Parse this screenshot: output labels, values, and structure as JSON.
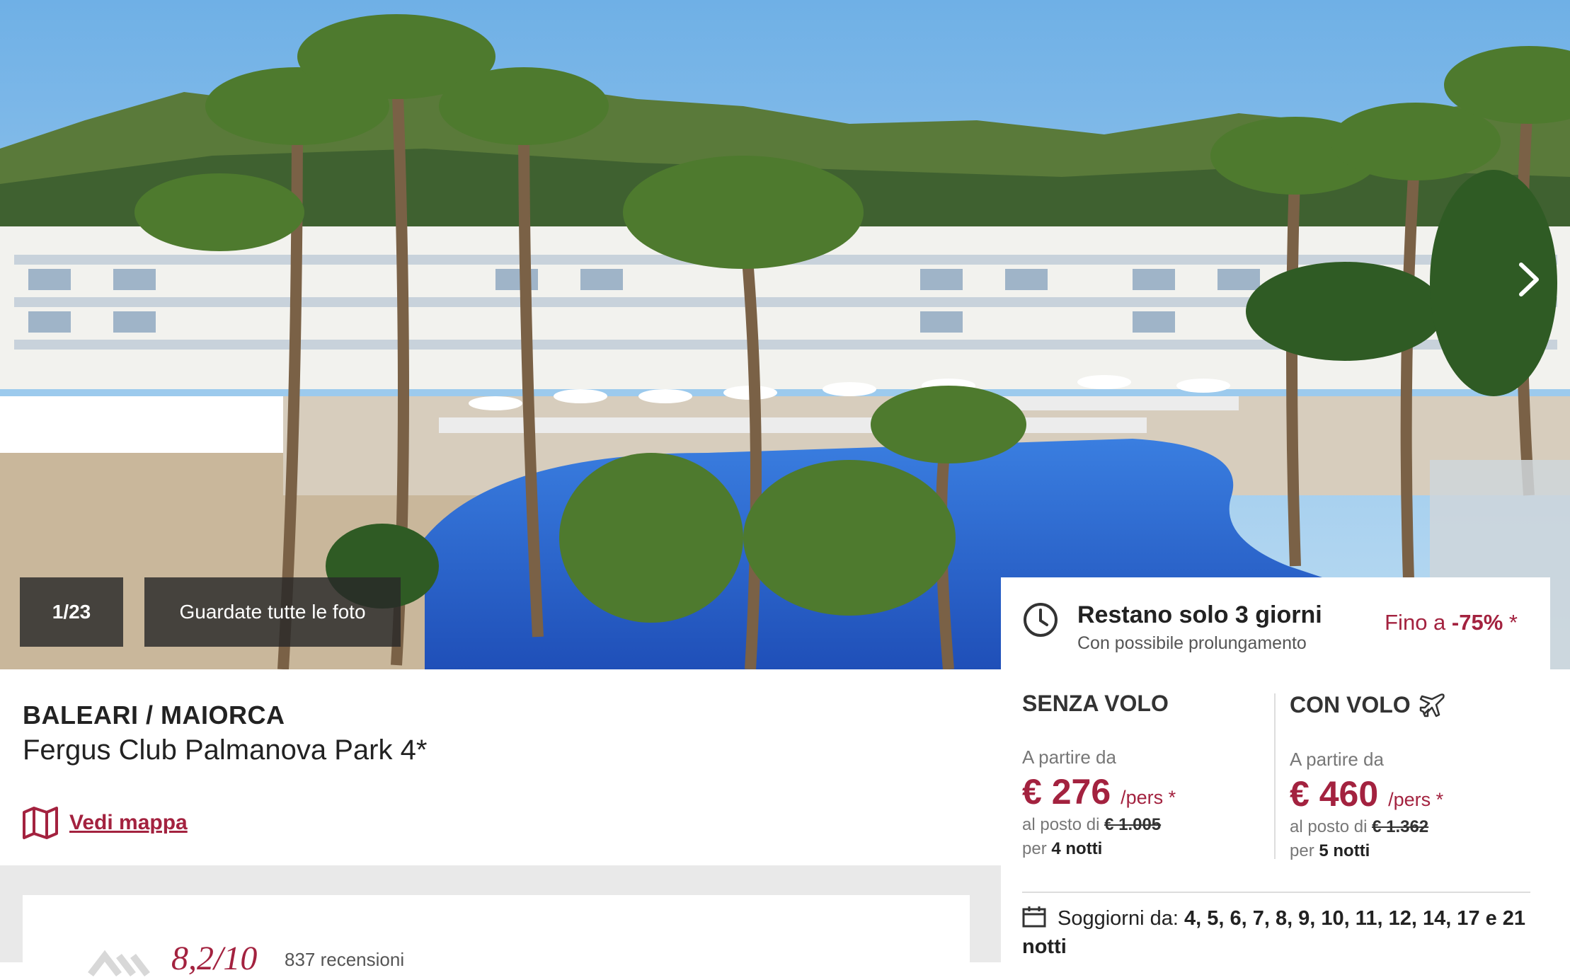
{
  "gallery": {
    "counter": "1/23",
    "all_photos": "Guardate tutte le foto"
  },
  "hotel": {
    "region": "BALEARI / MAIORCA",
    "name": "Fergus Club Palmanova Park 4*",
    "map_link": "Vedi mappa"
  },
  "reviews": {
    "score": "8,2/10",
    "count": "837 recensioni"
  },
  "offer": {
    "timer_title": "Restano solo 3 giorni",
    "timer_sub": "Con possibile prolungamento",
    "discount_prefix": "Fino a",
    "discount_value": "-75%",
    "discount_suffix": "*",
    "without_flight": {
      "title": "SENZA VOLO",
      "from_label": "A partire da",
      "price": "€ 276",
      "per": "/pers *",
      "old_label": "al posto di",
      "old_price": "€ 1.005",
      "nights_label": "per",
      "nights": "4 notti"
    },
    "with_flight": {
      "title": "CON VOLO",
      "from_label": "A partire da",
      "price": "€ 460",
      "per": "/pers *",
      "old_label": "al posto di",
      "old_price": "€ 1.362",
      "nights_label": "per",
      "nights": "5 notti"
    },
    "stays_label": "Soggiorni da:",
    "stays_value": "4, 5, 6, 7, 8, 9, 10, 11, 12, 14, 17 e 21 notti"
  },
  "colors": {
    "accent": "#a3223f",
    "sky": "#8ec3ea",
    "pool": "#2f6fd6"
  }
}
